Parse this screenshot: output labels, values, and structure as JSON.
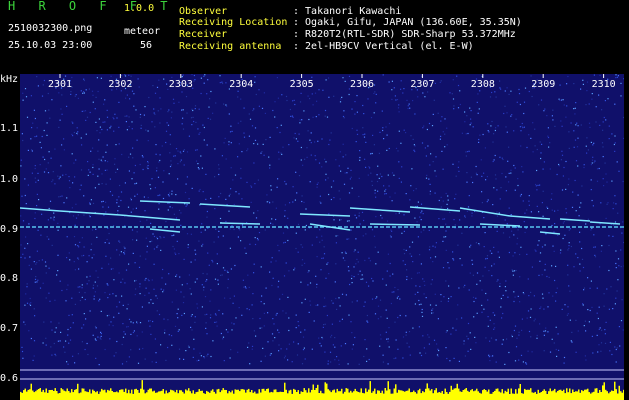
{
  "header": {
    "brand": "H R O F F T",
    "version": "1.0.0",
    "filename": "2510032300.png",
    "datetime": "25.10.03 23:00",
    "meteor_label": "meteor",
    "meteor_count": "56",
    "fields": [
      {
        "label": "Observer",
        "value": ": Takanori Kawachi"
      },
      {
        "label": "Receiving Location",
        "value": ": Ogaki, Gifu, JAPAN (136.60E, 35.35N)"
      },
      {
        "label": "Receiver",
        "value": ": R820T2(RTL-SDR) SDR-Sharp 53.372MHz"
      },
      {
        "label": "Receiving antenna",
        "value": ": 2el-HB9CV Vertical (el. E-W)"
      }
    ]
  },
  "axis": {
    "unit": "kHz",
    "x_ticks": [
      "2301",
      "2302",
      "2303",
      "2304",
      "2305",
      "2306",
      "2307",
      "2308",
      "2309",
      "2310"
    ],
    "y_ticks": [
      "1.1",
      "1.0",
      "0.9",
      "0.8",
      "0.7",
      "0.6"
    ]
  },
  "colors": {
    "background": "#10106a",
    "carrier": "#5fd8ff",
    "meteor": "#7fe8ff",
    "level_bars": "#ffff00",
    "header_green": "#3cd43c",
    "header_yellow": "#ffff3c"
  }
}
